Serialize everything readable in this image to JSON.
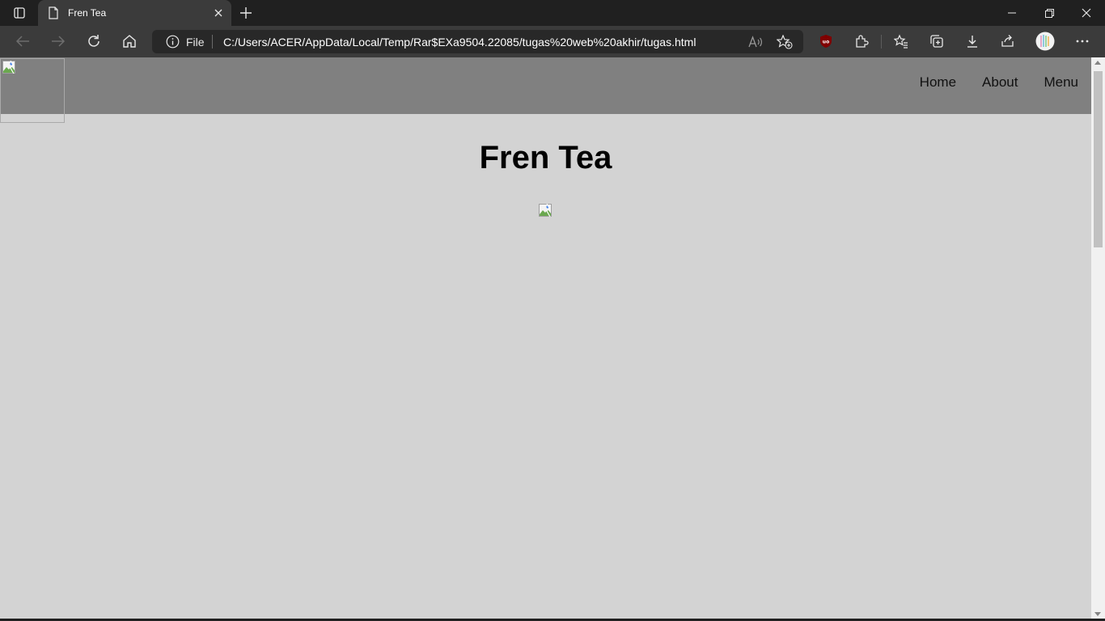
{
  "browser": {
    "tab": {
      "title": "Fren Tea"
    },
    "address": {
      "scheme": "File",
      "url": "C:/Users/ACER/AppData/Local/Temp/Rar$EXa9504.22085/tugas%20web%20akhir/tugas.html"
    },
    "toolbar_icons": [
      "back-icon",
      "forward-icon",
      "refresh-icon",
      "home-icon",
      "read-aloud-icon",
      "add-favorite-icon",
      "ublock-icon",
      "extensions-icon",
      "favorites-icon",
      "collections-icon",
      "downloads-icon",
      "share-icon",
      "profile-avatar",
      "more-icon"
    ],
    "colors": {
      "chrome_dark": "#202020",
      "toolbar": "#3b3b3b",
      "omnibox": "#282828",
      "ublock_red": "#800000"
    }
  },
  "page": {
    "nav": [
      {
        "label": "Home"
      },
      {
        "label": "About"
      },
      {
        "label": "Menu"
      }
    ],
    "heading": "Fren Tea",
    "colors": {
      "header_bg": "#808080",
      "body_bg": "#d3d3d3"
    }
  }
}
